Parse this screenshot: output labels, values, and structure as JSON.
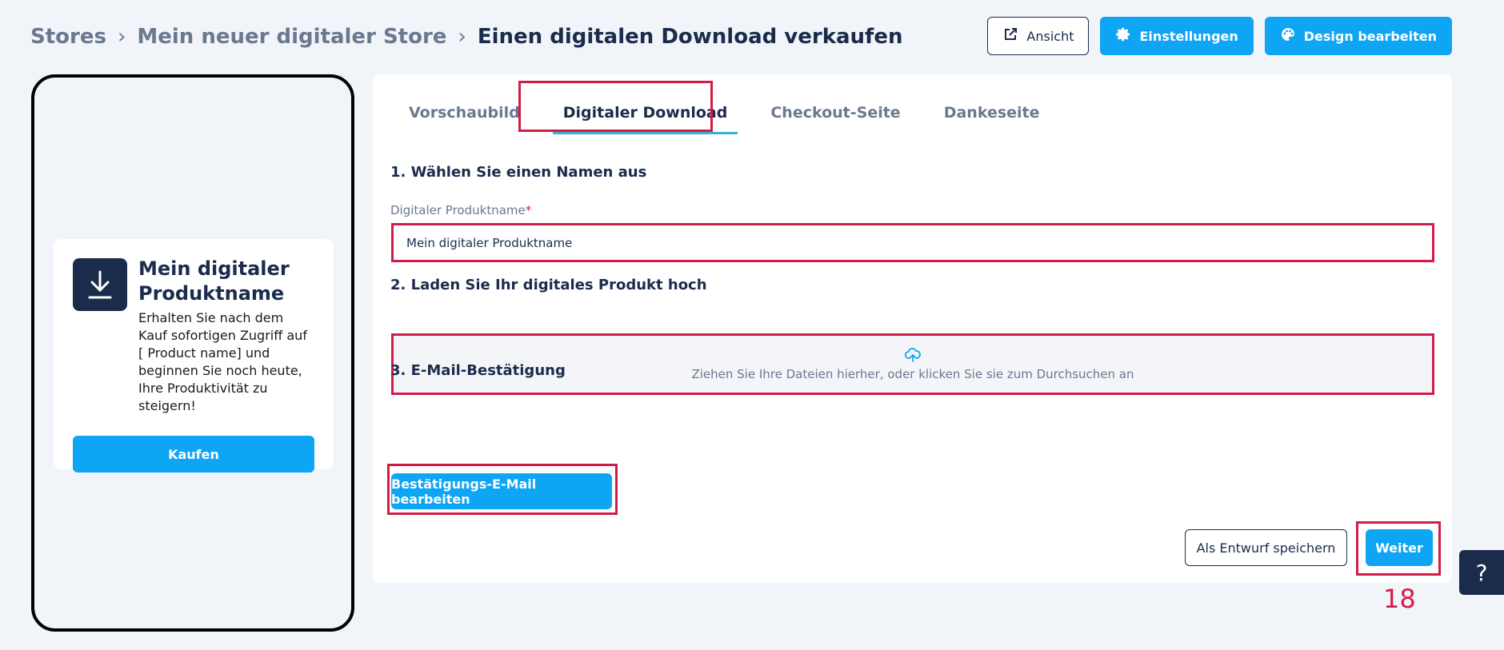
{
  "breadcrumb": {
    "items": [
      "Stores",
      "Mein neuer digitaler Store"
    ],
    "current": "Einen digitalen Download verkaufen",
    "separator": "›"
  },
  "header": {
    "view_label": "Ansicht",
    "settings_label": "Einstellungen",
    "design_label": "Design bearbeiten"
  },
  "preview": {
    "title": "Mein digitaler Produktname",
    "description": "Erhalten Sie nach dem Kauf sofortigen Zugriff auf [ Product name] und beginnen Sie noch heute, Ihre Produktivität zu steigern!",
    "buy_label": "Kaufen"
  },
  "tabs": [
    {
      "label": "Vorschaubild"
    },
    {
      "label": "Digitaler Download"
    },
    {
      "label": "Checkout-Seite"
    },
    {
      "label": "Dankeseite"
    }
  ],
  "form": {
    "section1_title": "1. Wählen Sie einen Namen aus",
    "name_label": "Digitaler Produktname",
    "required_mark": "*",
    "name_value": "Mein digitaler Produktname",
    "section2_title": "2. Laden Sie Ihr digitales Produkt hoch",
    "upload_text": "Ziehen Sie Ihre Dateien hierher, oder klicken Sie sie zum Durchsuchen an",
    "section3_title": "3. E-Mail-Bestätigung",
    "confirm_email_label": "Bestätigungs-E-Mail bearbeiten"
  },
  "footer": {
    "draft_label": "Als Entwurf speichern",
    "next_label": "Weiter"
  },
  "annotation": {
    "step_number": "18"
  },
  "help": {
    "label": "?"
  },
  "colors": {
    "accent": "#0ea5f5",
    "navy": "#1b2b4b",
    "highlight": "#d21c48",
    "background": "#f1f4f9"
  }
}
